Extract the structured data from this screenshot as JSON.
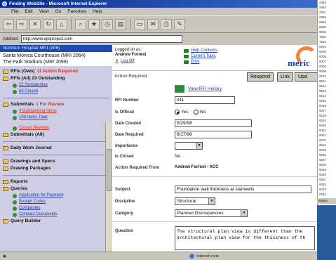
{
  "window": {
    "title": "Finding WebSite - Microsoft Internet Explorer"
  },
  "menu": [
    "File",
    "Edit",
    "View",
    "Go",
    "Favorites",
    "Help"
  ],
  "toolbar": {
    "back_label": "⇦",
    "forward_label": "⇨"
  },
  "address": {
    "label": "Address",
    "value": "http://www.epsproject.com"
  },
  "left": {
    "project_header": "Northern Hospital MRI (306)",
    "projects": [
      "Santa Monica Courthouse (MRI 2064)",
      "The Park Stadium (MRI 2099)"
    ],
    "sections": [
      {
        "label": "RFIs (Own)",
        "extra": "11 Action Required"
      },
      {
        "label": "RFIs (All) 23 Outstanding",
        "extra": ""
      }
    ],
    "rfi_subs": [
      "23 Outstanding",
      "63 Closed"
    ],
    "submittals": {
      "label": "Submittals",
      "extra": "1 For Review"
    },
    "submittal_subs": [
      "4 Outstanding Items",
      "168 Items Total"
    ],
    "submittal_subs2": [
      "Closed Reviews"
    ],
    "submittals_all": "Submittals (All)",
    "daily_work": "Daily Work Journal",
    "drawings_specs": "Drawings and Specs",
    "drawing_packages": "Drawing Packages",
    "reports": "Reports",
    "queries": "Queries",
    "query_items": [
      "Application for Payment",
      "Budget Codes",
      "Companies",
      "Contract Documents"
    ],
    "query_builder": "Query Builder"
  },
  "center": {
    "logged_label": "Logged on as:",
    "user": "Andrew Forrest",
    "logoff": "Log Off",
    "links": [
      "Help Contents",
      "Current Topic",
      "Print"
    ],
    "logo_text": "meric",
    "action_required": "Action Required",
    "buttons": {
      "respond": "Respond",
      "link": "Link",
      "update": "Upd"
    },
    "view_history": "View RFI History",
    "fields": {
      "rfi_number_label": "RFI Number",
      "rfi_number": "011",
      "is_official_label": "Is Official",
      "yes": "Yes",
      "no": "No",
      "date_created_label": "Date Created",
      "date_created": "5/29/98",
      "date_required_label": "Date Required",
      "date_required": "6/17/98",
      "importance_label": "Importance",
      "is_closed_label": "Is Closed",
      "is_closed": "No",
      "action_from_label": "Action Required From",
      "action_from": "Andrew Forrest - ACC",
      "subject_label": "Subject",
      "subject": "Foundation wall thickness at stairwells",
      "discipline_label": "Discipline",
      "discipline": "Structural",
      "category_label": "Category",
      "category": "Planned Discrepancies",
      "question_label": "Question",
      "question": "The structural plan view is different than the architectural plan view for the thickness of th"
    }
  },
  "status": {
    "zone": "Internet zone"
  },
  "background_window": {
    "items": [
      "2340",
      "2345",
      "2351",
      "2355",
      "6054",
      "6055",
      "6056",
      "7500",
      "7501",
      "9004",
      "9005",
      "9006",
      "9007",
      "9008",
      "9009",
      "9010",
      "9011",
      "9012",
      "9013",
      "9014",
      "9015",
      "9016",
      "9017",
      "9018",
      "9019",
      "9020",
      "9021",
      "9022",
      "9023",
      "9024",
      "9025",
      "9026",
      "9027",
      "9028",
      "9029",
      "9030",
      "9031",
      "9032",
      "9033",
      "9034"
    ],
    "status": "Status"
  }
}
